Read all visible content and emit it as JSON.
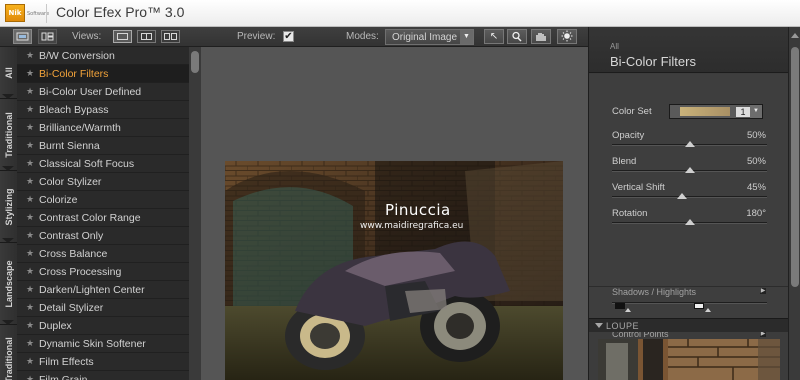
{
  "app": {
    "logo_text": "Nik",
    "logo_sub": "Software",
    "title": "Color Efex Pro™ 3.0"
  },
  "toolbar": {
    "views_label": "Views:",
    "preview_label": "Preview:",
    "preview_checked": "✔",
    "modes_label": "Modes:",
    "modes_value": "Original Image"
  },
  "category_tabs": [
    "All",
    "Traditional",
    "Stylizing",
    "Landscape",
    "Traditional"
  ],
  "filters": [
    {
      "label": "B/W Conversion"
    },
    {
      "label": "Bi-Color Filters",
      "selected": true
    },
    {
      "label": "Bi-Color User Defined"
    },
    {
      "label": "Bleach Bypass"
    },
    {
      "label": "Brilliance/Warmth"
    },
    {
      "label": "Burnt Sienna"
    },
    {
      "label": "Classical Soft Focus"
    },
    {
      "label": "Color Stylizer"
    },
    {
      "label": "Colorize"
    },
    {
      "label": "Contrast Color Range"
    },
    {
      "label": "Contrast Only"
    },
    {
      "label": "Cross Balance"
    },
    {
      "label": "Cross Processing"
    },
    {
      "label": "Darken/Lighten Center"
    },
    {
      "label": "Detail Stylizer"
    },
    {
      "label": "Duplex"
    },
    {
      "label": "Dynamic Skin Softener"
    },
    {
      "label": "Film Effects"
    },
    {
      "label": "Film Grain"
    }
  ],
  "preview": {
    "watermark_name": "Pinuccia",
    "watermark_url": "www.maidiregrafica.eu"
  },
  "panel": {
    "category": "All",
    "filter_name": "Bi-Color Filters",
    "color_set_label": "Color Set",
    "color_set_value": "1",
    "color_set_colors": [
      "#c9b27a",
      "#a99064"
    ],
    "params": [
      {
        "label": "Opacity",
        "value": "50%",
        "fraction": 0.5
      },
      {
        "label": "Blend",
        "value": "50%",
        "fraction": 0.5
      },
      {
        "label": "Vertical Shift",
        "value": "45%",
        "fraction": 0.45
      },
      {
        "label": "Rotation",
        "value": "180°",
        "fraction": 0.5
      }
    ],
    "shadows_highlights_label": "Shadows / Highlights",
    "control_points_label": "Control Points",
    "loupe_label": "LOUPE"
  }
}
